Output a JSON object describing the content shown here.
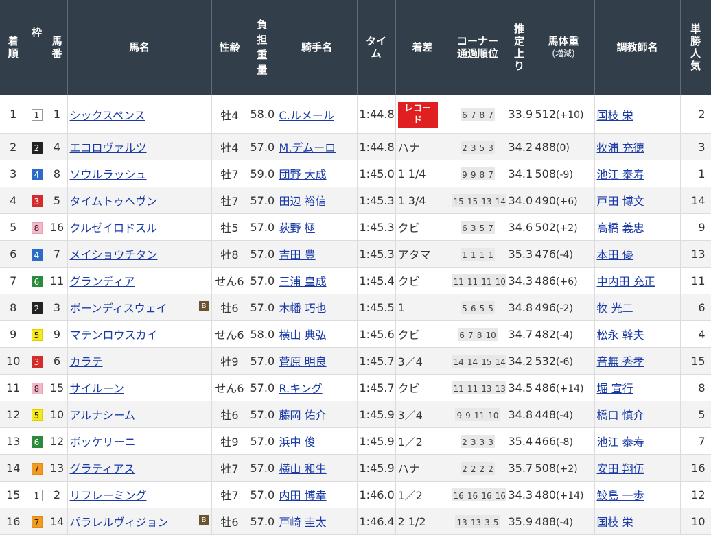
{
  "headers": {
    "rank": "着順",
    "waku": "枠",
    "umaban": "馬番",
    "horse": "馬名",
    "sexage": "性齢",
    "weight": "負担重量",
    "jockey": "騎手名",
    "time": "タイム",
    "margin": "着差",
    "corner": "コーナー通過順位",
    "last3f": "推定上り",
    "body_weight": "馬体重",
    "body_weight_sub": "(増減)",
    "trainer": "調教師名",
    "popularity": "単勝人気"
  },
  "rows": [
    {
      "rank": "1",
      "waku": "1",
      "umaban": "1",
      "horse": "シックスペンス",
      "blinker": "",
      "sexage": "牡4",
      "weight": "58.0",
      "jockey": "C.ルメール",
      "time": "1:44.8",
      "margin": "レコード",
      "record": true,
      "corner": [
        "6",
        "7",
        "8",
        "7"
      ],
      "last3f": "33.9",
      "bw": "512",
      "bwd": "(+10)",
      "trainer": "国枝 栄",
      "pop": "2"
    },
    {
      "rank": "2",
      "waku": "2",
      "umaban": "4",
      "horse": "エコロヴァルツ",
      "blinker": "",
      "sexage": "牡4",
      "weight": "57.0",
      "jockey": "M.デムーロ",
      "time": "1:44.8",
      "margin": "ハナ",
      "record": false,
      "corner": [
        "2",
        "3",
        "5",
        "3"
      ],
      "last3f": "34.2",
      "bw": "488",
      "bwd": "(0)",
      "trainer": "牧浦 充徳",
      "pop": "3"
    },
    {
      "rank": "3",
      "waku": "4",
      "umaban": "8",
      "horse": "ソウルラッシュ",
      "blinker": "",
      "sexage": "牡7",
      "weight": "59.0",
      "jockey": "団野 大成",
      "time": "1:45.0",
      "margin": "1 1/4",
      "record": false,
      "corner": [
        "9",
        "9",
        "8",
        "7"
      ],
      "last3f": "34.1",
      "bw": "508",
      "bwd": "(-9)",
      "trainer": "池江 泰寿",
      "pop": "1"
    },
    {
      "rank": "4",
      "waku": "3",
      "umaban": "5",
      "horse": "タイムトゥヘヴン",
      "blinker": "",
      "sexage": "牡7",
      "weight": "57.0",
      "jockey": "田辺 裕信",
      "time": "1:45.3",
      "margin": "1 3/4",
      "record": false,
      "corner": [
        "15",
        "15",
        "13",
        "14"
      ],
      "last3f": "34.0",
      "bw": "490",
      "bwd": "(+6)",
      "trainer": "戸田 博文",
      "pop": "14"
    },
    {
      "rank": "5",
      "waku": "8",
      "umaban": "16",
      "horse": "クルゼイロドスル",
      "blinker": "",
      "sexage": "牡5",
      "weight": "57.0",
      "jockey": "荻野 極",
      "time": "1:45.3",
      "margin": "クビ",
      "record": false,
      "corner": [
        "6",
        "3",
        "5",
        "7"
      ],
      "last3f": "34.6",
      "bw": "502",
      "bwd": "(+2)",
      "trainer": "高橋 義忠",
      "pop": "9"
    },
    {
      "rank": "6",
      "waku": "4",
      "umaban": "7",
      "horse": "メイショウチタン",
      "blinker": "",
      "sexage": "牡8",
      "weight": "57.0",
      "jockey": "吉田 豊",
      "time": "1:45.3",
      "margin": "アタマ",
      "record": false,
      "corner": [
        "1",
        "1",
        "1",
        "1"
      ],
      "last3f": "35.3",
      "bw": "476",
      "bwd": "(-4)",
      "trainer": "本田 優",
      "pop": "13"
    },
    {
      "rank": "7",
      "waku": "6",
      "umaban": "11",
      "horse": "グランディア",
      "blinker": "",
      "sexage": "せん6",
      "weight": "57.0",
      "jockey": "三浦 皇成",
      "time": "1:45.4",
      "margin": "クビ",
      "record": false,
      "corner": [
        "11",
        "11",
        "11",
        "10"
      ],
      "last3f": "34.3",
      "bw": "486",
      "bwd": "(+6)",
      "trainer": "中内田 充正",
      "pop": "11"
    },
    {
      "rank": "8",
      "waku": "2",
      "umaban": "3",
      "horse": "ボーンディスウェイ",
      "blinker": "B",
      "sexage": "牡6",
      "weight": "57.0",
      "jockey": "木幡 巧也",
      "time": "1:45.5",
      "margin": "1",
      "record": false,
      "corner": [
        "5",
        "6",
        "5",
        "5"
      ],
      "last3f": "34.8",
      "bw": "496",
      "bwd": "(-2)",
      "trainer": "牧 光二",
      "pop": "6"
    },
    {
      "rank": "9",
      "waku": "5",
      "umaban": "9",
      "horse": "マテンロウスカイ",
      "blinker": "",
      "sexage": "せん6",
      "weight": "58.0",
      "jockey": "横山 典弘",
      "time": "1:45.6",
      "margin": "クビ",
      "record": false,
      "corner": [
        "6",
        "7",
        "8",
        "10"
      ],
      "last3f": "34.7",
      "bw": "482",
      "bwd": "(-4)",
      "trainer": "松永 幹夫",
      "pop": "4"
    },
    {
      "rank": "10",
      "waku": "3",
      "umaban": "6",
      "horse": "カラテ",
      "blinker": "",
      "sexage": "牡9",
      "weight": "57.0",
      "jockey": "菅原 明良",
      "time": "1:45.7",
      "margin": "3／4",
      "record": false,
      "corner": [
        "14",
        "14",
        "15",
        "14"
      ],
      "last3f": "34.2",
      "bw": "532",
      "bwd": "(-6)",
      "trainer": "音無 秀孝",
      "pop": "15"
    },
    {
      "rank": "11",
      "waku": "8",
      "umaban": "15",
      "horse": "サイルーン",
      "blinker": "",
      "sexage": "せん6",
      "weight": "57.0",
      "jockey": "R.キング",
      "time": "1:45.7",
      "margin": "クビ",
      "record": false,
      "corner": [
        "11",
        "11",
        "13",
        "13"
      ],
      "last3f": "34.5",
      "bw": "486",
      "bwd": "(+14)",
      "trainer": "堀 宣行",
      "pop": "8"
    },
    {
      "rank": "12",
      "waku": "5",
      "umaban": "10",
      "horse": "アルナシーム",
      "blinker": "",
      "sexage": "牡6",
      "weight": "57.0",
      "jockey": "藤岡 佑介",
      "time": "1:45.9",
      "margin": "3／4",
      "record": false,
      "corner": [
        "9",
        "9",
        "11",
        "10"
      ],
      "last3f": "34.8",
      "bw": "448",
      "bwd": "(-4)",
      "trainer": "橋口 慎介",
      "pop": "5"
    },
    {
      "rank": "13",
      "waku": "6",
      "umaban": "12",
      "horse": "ボッケリーニ",
      "blinker": "",
      "sexage": "牡9",
      "weight": "57.0",
      "jockey": "浜中 俊",
      "time": "1:45.9",
      "margin": "1／2",
      "record": false,
      "corner": [
        "2",
        "3",
        "3",
        "3"
      ],
      "last3f": "35.4",
      "bw": "466",
      "bwd": "(-8)",
      "trainer": "池江 泰寿",
      "pop": "7"
    },
    {
      "rank": "14",
      "waku": "7",
      "umaban": "13",
      "horse": "グラティアス",
      "blinker": "",
      "sexage": "牡7",
      "weight": "57.0",
      "jockey": "横山 和生",
      "time": "1:45.9",
      "margin": "ハナ",
      "record": false,
      "corner": [
        "2",
        "2",
        "2",
        "2"
      ],
      "last3f": "35.7",
      "bw": "508",
      "bwd": "(+2)",
      "trainer": "安田 翔伍",
      "pop": "16"
    },
    {
      "rank": "15",
      "waku": "1",
      "umaban": "2",
      "horse": "リフレーミング",
      "blinker": "",
      "sexage": "牡7",
      "weight": "57.0",
      "jockey": "内田 博幸",
      "time": "1:46.0",
      "margin": "1／2",
      "record": false,
      "corner": [
        "16",
        "16",
        "16",
        "16"
      ],
      "last3f": "34.3",
      "bw": "480",
      "bwd": "(+14)",
      "trainer": "鮫島 一歩",
      "pop": "12"
    },
    {
      "rank": "16",
      "waku": "7",
      "umaban": "14",
      "horse": "パラレルヴィジョン",
      "blinker": "B",
      "sexage": "牡6",
      "weight": "57.0",
      "jockey": "戸崎 圭太",
      "time": "1:46.4",
      "margin": "2 1/2",
      "record": false,
      "corner": [
        "13",
        "13",
        "3",
        "5"
      ],
      "last3f": "35.9",
      "bw": "488",
      "bwd": "(-4)",
      "trainer": "国枝 栄",
      "pop": "10"
    }
  ]
}
